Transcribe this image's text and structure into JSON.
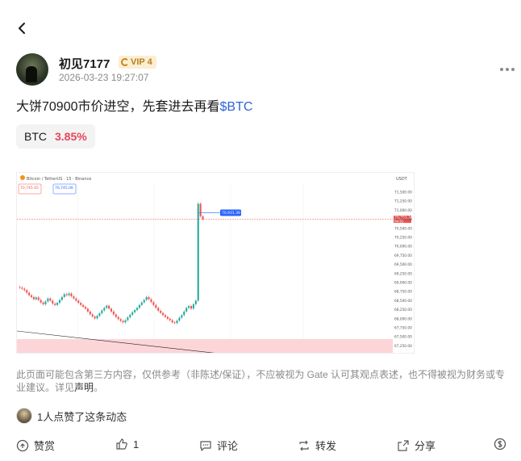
{
  "header": {
    "back_icon": "chevron-left-icon"
  },
  "author": {
    "name": "初见7177",
    "vip_label": "VIP 4",
    "timestamp": "2026-03-23 19:27:07"
  },
  "post": {
    "text": "大饼70900市价进空，先套进去再看",
    "tag": "$BTC"
  },
  "coin": {
    "symbol": "BTC",
    "change": "3.85%",
    "change_color": "#e8455b"
  },
  "chart_image": {
    "header": "Bitcoin / TetherUS · 15 · Binance",
    "quote_left": "70,745.05",
    "quote_right": "70,745.06",
    "marker_price": "70,931.39",
    "last_price": "70,751.36",
    "countdown": "04:01",
    "currency": "USDT",
    "price_ticks": [
      "71,500.00",
      "71,250.00",
      "71,000.00",
      "70,750.00",
      "70,500.00",
      "70,250.00",
      "70,000.00",
      "69,750.00",
      "69,500.00",
      "69,250.00",
      "69,000.00",
      "68,750.00",
      "68,500.00",
      "68,250.00",
      "68,000.00",
      "67,750.00",
      "67,500.00",
      "67,250.00"
    ]
  },
  "disclaimer": {
    "text": "此页面可能包含第三方内容，仅供参考（非陈述/保证），不应被视为 Gate 认可其观点表述，也不得被视为财务或专业建议。详见",
    "link": "声明",
    "end": "。"
  },
  "likers": {
    "text": "1人点赞了这条动态"
  },
  "actions": {
    "tip_label": "赞赏",
    "like_count": "1",
    "comment_label": "评论",
    "repost_label": "转发",
    "share_label": "分享"
  },
  "colors": {
    "up": "#26a69a",
    "down": "#ef5350",
    "link": "#2e64d8",
    "vip_bg": "#fbeed2",
    "vip_text": "#b7801d"
  }
}
